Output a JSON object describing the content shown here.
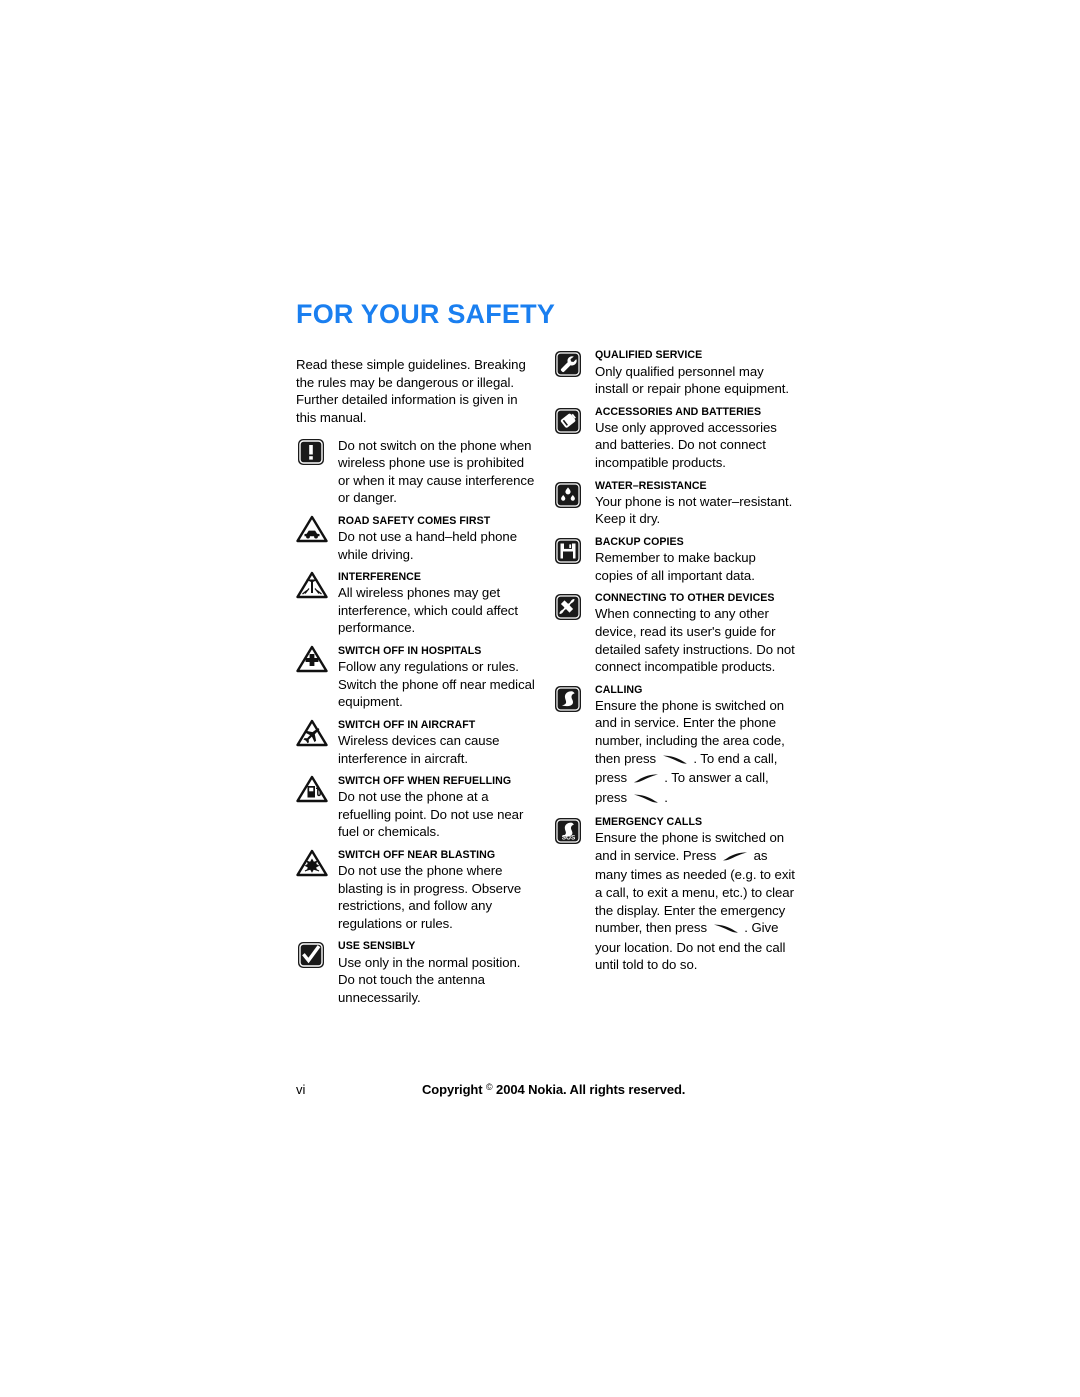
{
  "page": {
    "title": "FOR YOUR SAFETY",
    "title_color": "#1a7ff0",
    "intro": "Read these simple guidelines. Breaking the rules may be dangerous or illegal. Further detailed information is given in this manual."
  },
  "left_column": {
    "items": [
      {
        "icon": "exclamation-square-icon",
        "heading": "",
        "text": "Do not switch on the phone when wireless phone use is prohibited or when it may cause interference or danger."
      },
      {
        "icon": "car-triangle-warning-icon",
        "heading": "ROAD SAFETY COMES FIRST",
        "text": "Do not use a hand–held phone while driving."
      },
      {
        "icon": "interference-triangle-warning-icon",
        "heading": "INTERFERENCE",
        "text": "All wireless phones may get interference, which could affect performance."
      },
      {
        "icon": "hospital-cross-triangle-warning-icon",
        "heading": "SWITCH OFF IN HOSPITALS",
        "text": "Follow any regulations or rules. Switch the phone off near medical equipment."
      },
      {
        "icon": "aircraft-triangle-warning-icon",
        "heading": "SWITCH OFF IN AIRCRAFT",
        "text": "Wireless devices can cause interference in aircraft."
      },
      {
        "icon": "fuel-pump-triangle-warning-icon",
        "heading": "SWITCH OFF WHEN REFUELLING",
        "text": "Do not use the phone at a refuelling point. Do not use near fuel or chemicals."
      },
      {
        "icon": "blasting-triangle-warning-icon",
        "heading": "SWITCH OFF NEAR BLASTING",
        "text": "Do not use the phone where blasting is in progress. Observe restrictions, and follow any regulations or rules."
      },
      {
        "icon": "checkmark-square-icon",
        "heading": "USE SENSIBLY",
        "text": "Use only in the normal position. Do not touch the antenna unnecessarily."
      }
    ]
  },
  "right_column": {
    "items": [
      {
        "icon": "wrench-square-icon",
        "heading": "QUALIFIED SERVICE",
        "text": "Only qualified personnel may install or repair phone equipment."
      },
      {
        "icon": "battery-square-icon",
        "heading": "ACCESSORIES AND BATTERIES",
        "text": "Use only approved accessories and batteries. Do not connect incompatible products."
      },
      {
        "icon": "water-drops-square-icon",
        "heading": "WATER–RESISTANCE",
        "text": "Your phone is not water–resistant. Keep it dry."
      },
      {
        "icon": "floppy-disk-square-icon",
        "heading": "BACKUP COPIES",
        "text": "Remember to make backup copies of all important data."
      },
      {
        "icon": "connector-plug-square-icon",
        "heading": "CONNECTING TO OTHER DEVICES",
        "text": "When connecting to any other device, read its user's guide for detailed safety instructions. Do not connect incompatible products."
      },
      {
        "icon": "handset-square-icon",
        "heading": "CALLING",
        "text_parts": [
          "Ensure the phone is switched on and in service. Enter the phone number, including the area code, then press ",
          {
            "glyph": "call-send-key-glyph"
          },
          " . To end a call, press ",
          {
            "glyph": "call-end-key-glyph"
          },
          " . To answer a call, press ",
          {
            "glyph": "call-send-key-glyph"
          },
          " ."
        ]
      },
      {
        "icon": "emergency-sos-handset-square-icon",
        "heading": "EMERGENCY CALLS",
        "text_parts": [
          "Ensure the phone is switched on and in service. Press ",
          {
            "glyph": "call-end-key-glyph"
          },
          " as many times as needed (e.g. to exit a call, to exit a menu, etc.) to clear the display. Enter the emergency number, then press ",
          {
            "glyph": "call-send-key-glyph"
          },
          " . Give your location. Do not end the call until told to do so."
        ]
      }
    ]
  },
  "footer": {
    "folio": "vi",
    "copyright_before": "Copyright ",
    "copyright_symbol": "©",
    "copyright_after": " 2004 Nokia. All rights reserved."
  }
}
